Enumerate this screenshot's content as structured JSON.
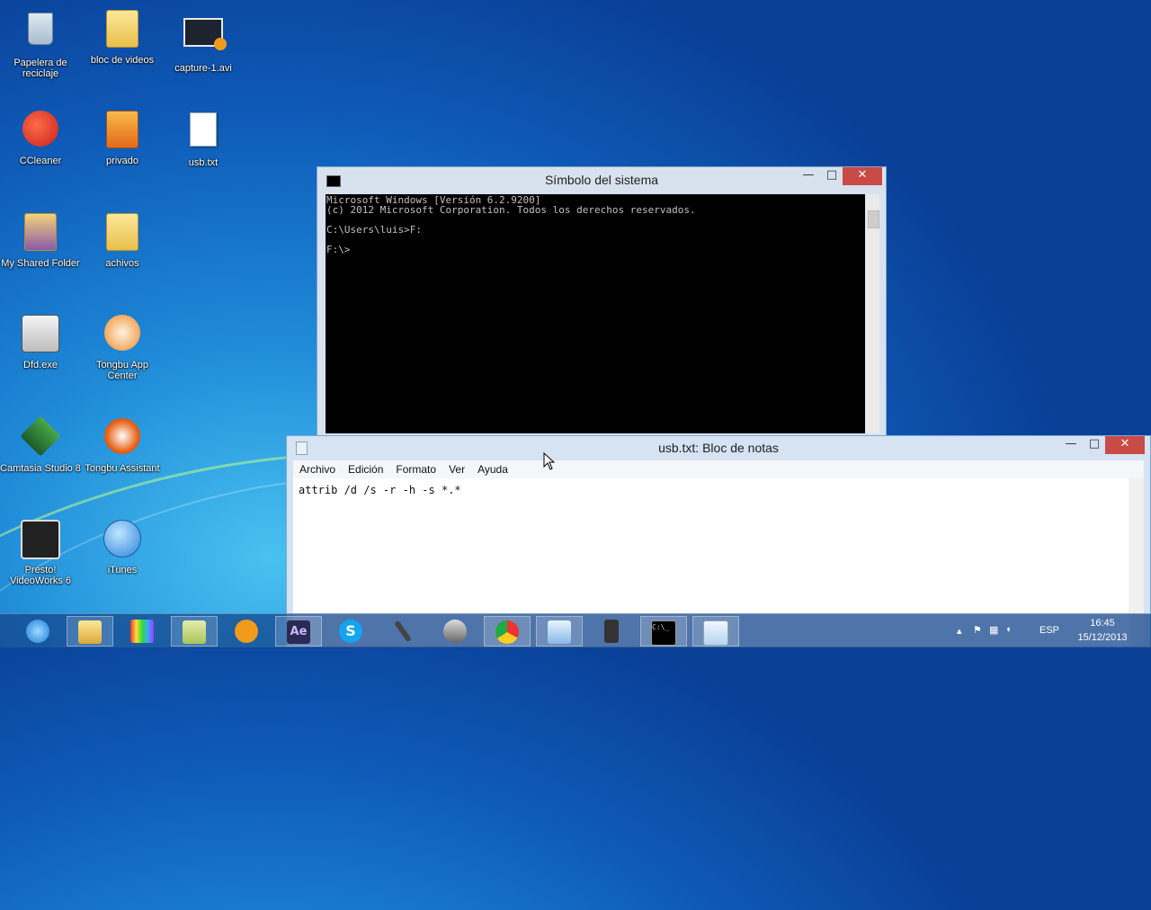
{
  "desktop_icons": [
    {
      "label": "Papelera de reciclaje",
      "icon": "recycle-bin-icon"
    },
    {
      "label": "bloc de videos",
      "icon": "folder-icon"
    },
    {
      "label": "capture-1.avi",
      "icon": "video-file-icon"
    },
    {
      "label": "CCleaner",
      "icon": "ccleaner-icon"
    },
    {
      "label": "privado",
      "icon": "locked-folder-icon"
    },
    {
      "label": "usb.txt",
      "icon": "text-file-icon"
    },
    {
      "label": "My Shared Folder",
      "icon": "shared-folder-icon"
    },
    {
      "label": "achivos",
      "icon": "folder-icon"
    },
    {
      "label": "Dfd.exe",
      "icon": "dfd-icon"
    },
    {
      "label": "Tongbu App Center",
      "icon": "tongbu-icon"
    },
    {
      "label": "Camtasia Studio 8",
      "icon": "camtasia-icon"
    },
    {
      "label": "Tongbu Assistant",
      "icon": "tongbu-assistant-icon"
    },
    {
      "label": "Presto! VideoWorks 6",
      "icon": "videoworks-icon"
    },
    {
      "label": "iTunes",
      "icon": "itunes-icon"
    }
  ],
  "cmd_window": {
    "title": "Símbolo del sistema",
    "lines": [
      "Microsoft Windows [Versión 6.2.9200]",
      "(c) 2012 Microsoft Corporation. Todos los derechos reservados.",
      "",
      "C:\\Users\\luis>F:",
      "",
      "F:\\>"
    ],
    "minimize": "—",
    "maximize": "□",
    "close": "✕"
  },
  "notepad_window": {
    "title": "usb.txt: Bloc de notas",
    "menu": [
      "Archivo",
      "Edición",
      "Formato",
      "Ver",
      "Ayuda"
    ],
    "content": "attrib /d /s -r -h -s *.*",
    "minimize": "—",
    "maximize": "□",
    "close": "✕"
  },
  "taskbar": {
    "apps": [
      "internet-explorer-icon",
      "file-explorer-icon",
      "media-app-icon",
      "notes-app-icon",
      "video-player-icon",
      "after-effects-icon",
      "skype-icon",
      "microphone-icon",
      "film-icon",
      "chrome-icon",
      "control-panel-icon",
      "camera-icon",
      "cmd-icon",
      "notepad-icon"
    ],
    "after_effects_label": "Ae",
    "skype_label": "S",
    "cmd_label": "C:\\_",
    "language": "ESP",
    "time": "16:45",
    "date": "15/12/2013"
  }
}
